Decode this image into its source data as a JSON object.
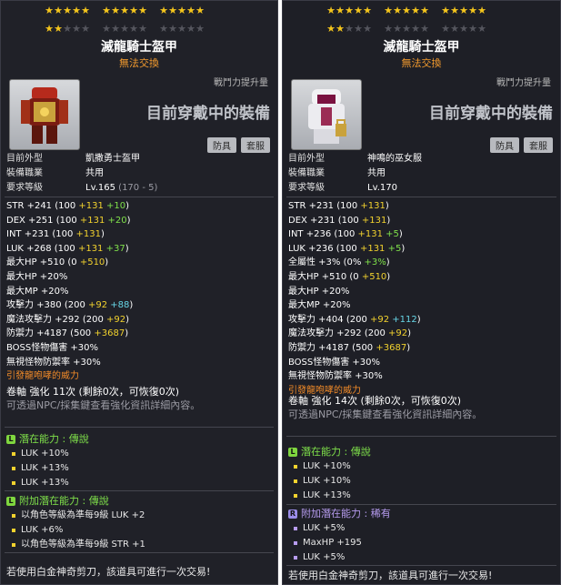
{
  "left": {
    "item_name": "滅龍騎士盔甲",
    "trade_note": "無法交換",
    "power_label": "戰鬥力提升量",
    "equipped_label": "目前穿戴中的裝備",
    "tags": [
      "防具",
      "套服"
    ],
    "stars_filled": 17,
    "stars_total": 30,
    "info": [
      {
        "k": "目前外型",
        "v": "凱撒勇士盔甲"
      },
      {
        "k": "裝備職業",
        "v": "共用"
      },
      {
        "k": "要求等級",
        "v": "Lv.165",
        "extra": "(170 - 5)"
      }
    ],
    "stats": [
      [
        {
          "t": "STR  +241 (100 ",
          "c": "white"
        },
        {
          "t": "+131",
          "c": "yellow"
        },
        {
          "t": " +10",
          "c": "green"
        },
        {
          "t": ")",
          "c": "white"
        }
      ],
      [
        {
          "t": "DEX  +251 (100 ",
          "c": "white"
        },
        {
          "t": "+131",
          "c": "yellow"
        },
        {
          "t": " +20",
          "c": "green"
        },
        {
          "t": ")",
          "c": "white"
        }
      ],
      [
        {
          "t": "INT  +231 (100 ",
          "c": "white"
        },
        {
          "t": "+131",
          "c": "yellow"
        },
        {
          "t": ")",
          "c": "white"
        }
      ],
      [
        {
          "t": "LUK  +268 (100 ",
          "c": "white"
        },
        {
          "t": "+131",
          "c": "yellow"
        },
        {
          "t": " +37",
          "c": "green"
        },
        {
          "t": ")",
          "c": "white"
        }
      ],
      [
        {
          "t": "最大HP  +510 (0 ",
          "c": "white"
        },
        {
          "t": "+510",
          "c": "yellow"
        },
        {
          "t": ")",
          "c": "white"
        }
      ],
      [
        {
          "t": "最大HP  +20%",
          "c": "white"
        }
      ],
      [
        {
          "t": "最大MP  +20%",
          "c": "white"
        }
      ],
      [
        {
          "t": "攻擊力  +380 (200 ",
          "c": "white"
        },
        {
          "t": "+92",
          "c": "yellow"
        },
        {
          "t": " +88",
          "c": "cyan2"
        },
        {
          "t": ")",
          "c": "white"
        }
      ],
      [
        {
          "t": "魔法攻擊力  +292 (200 ",
          "c": "white"
        },
        {
          "t": "+92",
          "c": "yellow"
        },
        {
          "t": ")",
          "c": "white"
        }
      ],
      [
        {
          "t": "防禦力  +4187 (500 ",
          "c": "white"
        },
        {
          "t": "+3687",
          "c": "yellow"
        },
        {
          "t": ")",
          "c": "white"
        }
      ],
      [
        {
          "t": "BOSS怪物傷害  +30%",
          "c": "white"
        }
      ],
      [
        {
          "t": "無視怪物防禦率  +30%",
          "c": "white"
        }
      ],
      [
        {
          "t": "引發龍咆哮的威力",
          "c": "orange-title"
        }
      ]
    ],
    "scroll_line": "卷軸 強化 11次 (剩餘0次，可恢復0次)",
    "scroll_note": "可透過NPC/採集鍵查看強化資訊詳細內容。",
    "potential": {
      "title": "潛在能力 : 傳說",
      "badge": "L",
      "lines": [
        "LUK +10%",
        "LUK +13%",
        "LUK +13%"
      ]
    },
    "bonus_potential": {
      "title": "附加潛在能力 : 傳說",
      "badge": "L",
      "lines": [
        "以角色等級為準每9級 LUK +2",
        "LUK +6%",
        "以角色等級為準每9級 STR +1"
      ]
    },
    "footer": "若使用白金神奇剪刀，該道具可進行一次交易!"
  },
  "right": {
    "item_name": "滅龍騎士盔甲",
    "trade_note": "無法交換",
    "power_label": "戰鬥力提升量",
    "equipped_label": "目前穿戴中的裝備",
    "tags": [
      "防具",
      "套服"
    ],
    "stars_filled": 17,
    "stars_total": 30,
    "info": [
      {
        "k": "目前外型",
        "v": "神鳴的巫女服"
      },
      {
        "k": "裝備職業",
        "v": "共用"
      },
      {
        "k": "要求等級",
        "v": "Lv.170"
      }
    ],
    "stats": [
      [
        {
          "t": "STR  +231 (100 ",
          "c": "white"
        },
        {
          "t": "+131",
          "c": "yellow"
        },
        {
          "t": ")",
          "c": "white"
        }
      ],
      [
        {
          "t": "DEX  +231 (100 ",
          "c": "white"
        },
        {
          "t": "+131",
          "c": "yellow"
        },
        {
          "t": ")",
          "c": "white"
        }
      ],
      [
        {
          "t": "INT  +236 (100 ",
          "c": "white"
        },
        {
          "t": "+131",
          "c": "yellow"
        },
        {
          "t": " +5",
          "c": "green"
        },
        {
          "t": ")",
          "c": "white"
        }
      ],
      [
        {
          "t": "LUK  +236 (100 ",
          "c": "white"
        },
        {
          "t": "+131",
          "c": "yellow"
        },
        {
          "t": " +5",
          "c": "green"
        },
        {
          "t": ")",
          "c": "white"
        }
      ],
      [
        {
          "t": "全屬性  +3% (0% ",
          "c": "white"
        },
        {
          "t": "+3%",
          "c": "green"
        },
        {
          "t": ")",
          "c": "white"
        }
      ],
      [
        {
          "t": "最大HP  +510 (0 ",
          "c": "white"
        },
        {
          "t": "+510",
          "c": "yellow"
        },
        {
          "t": ")",
          "c": "white"
        }
      ],
      [
        {
          "t": "最大HP  +20%",
          "c": "white"
        }
      ],
      [
        {
          "t": "最大MP  +20%",
          "c": "white"
        }
      ],
      [
        {
          "t": "攻擊力  +404 (200 ",
          "c": "white"
        },
        {
          "t": "+92",
          "c": "yellow"
        },
        {
          "t": " +112",
          "c": "cyan2"
        },
        {
          "t": ")",
          "c": "white"
        }
      ],
      [
        {
          "t": "魔法攻擊力  +292 (200 ",
          "c": "white"
        },
        {
          "t": "+92",
          "c": "yellow"
        },
        {
          "t": ")",
          "c": "white"
        }
      ],
      [
        {
          "t": "防禦力  +4187 (500 ",
          "c": "white"
        },
        {
          "t": "+3687",
          "c": "yellow"
        },
        {
          "t": ")",
          "c": "white"
        }
      ],
      [
        {
          "t": "BOSS怪物傷害  +30%",
          "c": "white"
        }
      ],
      [
        {
          "t": "無視怪物防禦率  +30%",
          "c": "white"
        }
      ],
      [
        {
          "t": "引發龍咆哮的威力",
          "c": "orange-title"
        }
      ]
    ],
    "scroll_line": "卷軸 強化 14次 (剩餘0次，可恢復0次)",
    "scroll_note": "可透過NPC/採集鍵查看強化資訊詳細內容。",
    "potential": {
      "title": "潛在能力 : 傳說",
      "badge": "L",
      "lines": [
        "LUK +10%",
        "LUK +10%",
        "LUK +13%"
      ]
    },
    "bonus_potential": {
      "title": "附加潛在能力 : 稀有",
      "badge": "R",
      "lines": [
        "LUK +5%",
        "MaxHP +195",
        "LUK +5%"
      ]
    },
    "footer": "若使用白金神奇剪刀，該道具可進行一次交易!"
  }
}
